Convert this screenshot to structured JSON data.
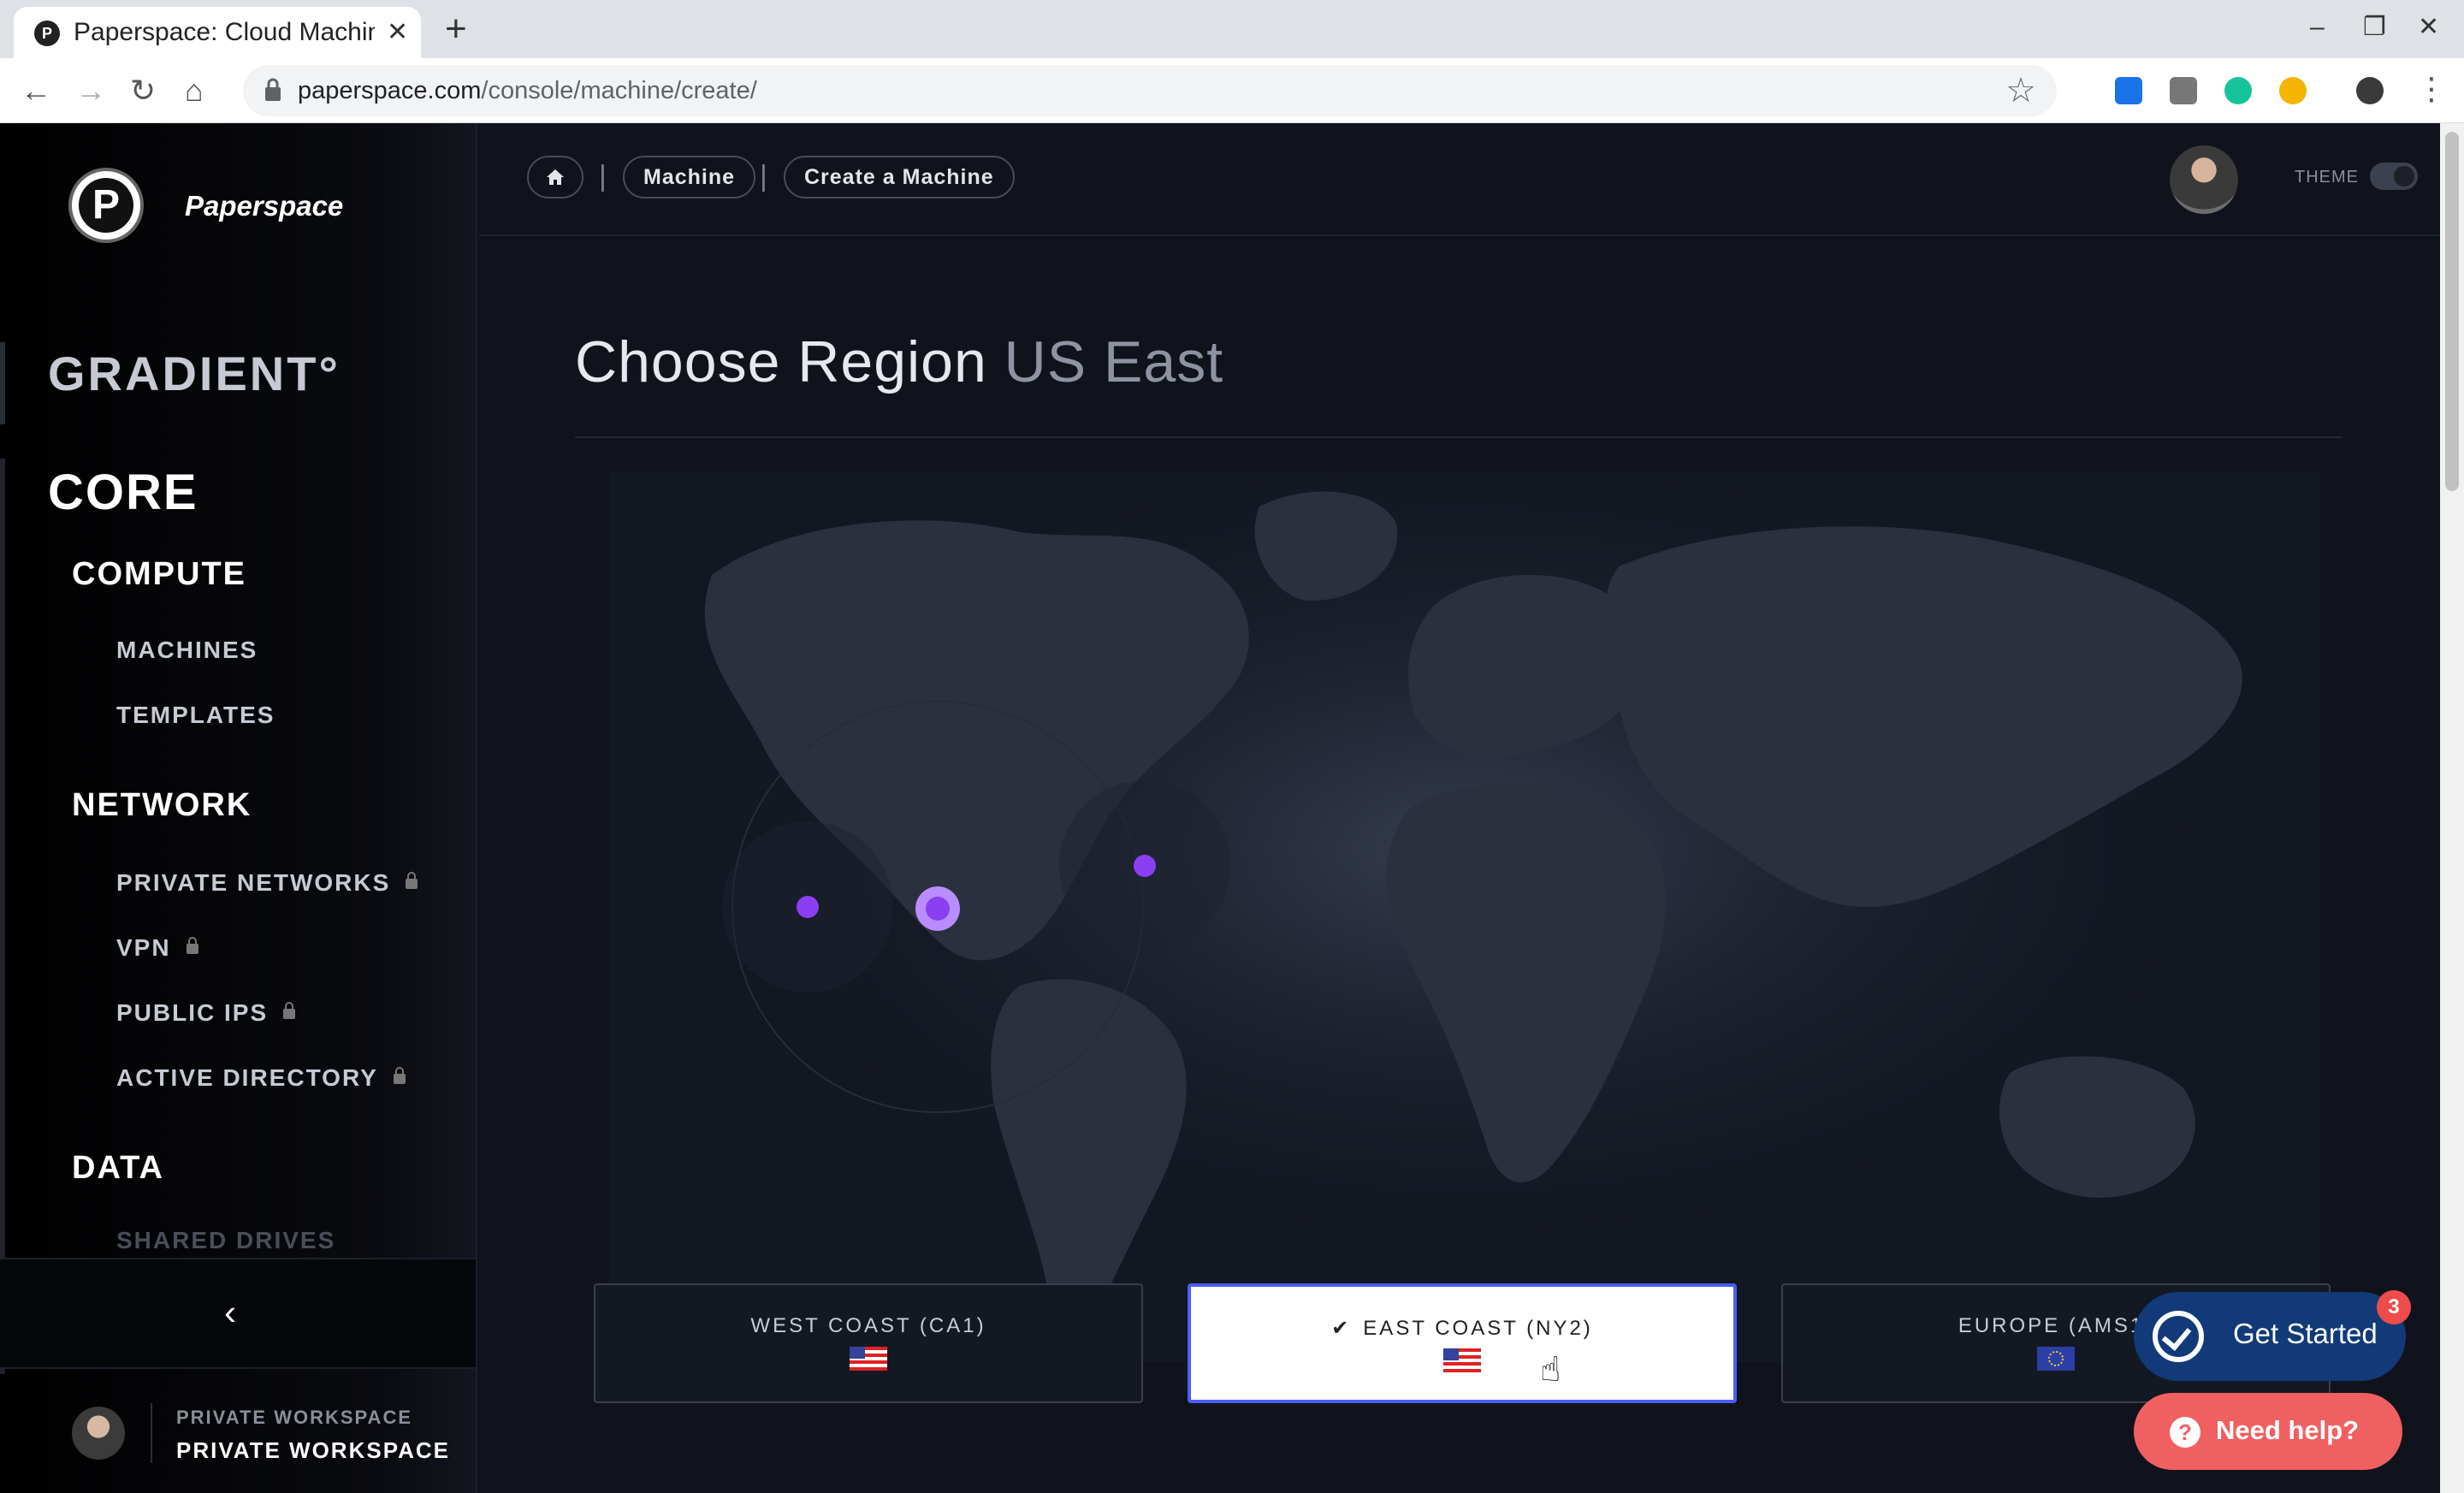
{
  "browser": {
    "tab_title": "Paperspace: Cloud Machine",
    "url_domain": "paperspace.com",
    "url_path": "/console/machine/create/",
    "window_controls": {
      "minimize": "–",
      "restore": "❐",
      "close": "✕"
    },
    "new_tab": "+",
    "tab_close": "✕"
  },
  "sidebar": {
    "brand": "Paperspace",
    "logo_letter": "P",
    "gradient": "GRADIENT°",
    "core": "CORE",
    "sections": {
      "compute": "COMPUTE",
      "network": "NETWORK",
      "data": "DATA"
    },
    "items": {
      "machines": "MACHINES",
      "templates": "TEMPLATES",
      "private_networks": "PRIVATE NETWORKS",
      "vpn": "VPN",
      "public_ips": "PUBLIC IPS",
      "active_directory": "ACTIVE DIRECTORY",
      "shared_drives": "SHARED DRIVES"
    },
    "collapse_icon": "‹",
    "workspace_label": "PRIVATE WORKSPACE",
    "workspace_name": "PRIVATE WORKSPACE"
  },
  "header": {
    "breadcrumb": {
      "home_icon": "home-icon",
      "machine": "Machine",
      "create": "Create a Machine"
    },
    "theme_label": "THEME"
  },
  "main": {
    "title": "Choose Region",
    "selected_region": "US East",
    "regions": [
      {
        "label": "WEST COAST (CA1)",
        "flag": "us",
        "selected": false
      },
      {
        "label": "EAST COAST (NY2)",
        "flag": "us",
        "selected": true
      },
      {
        "label": "EUROPE (AMS1)",
        "flag": "eu",
        "selected": false
      }
    ],
    "check_mark": "✔"
  },
  "widgets": {
    "get_started": "Get Started",
    "get_started_badge": "3",
    "need_help": "Need help?",
    "need_help_icon": "?"
  },
  "colors": {
    "accent": "#4b5cff",
    "marker": "#8a3ff0",
    "get_started_bg": "#123a79",
    "need_help_bg": "#f06060"
  }
}
